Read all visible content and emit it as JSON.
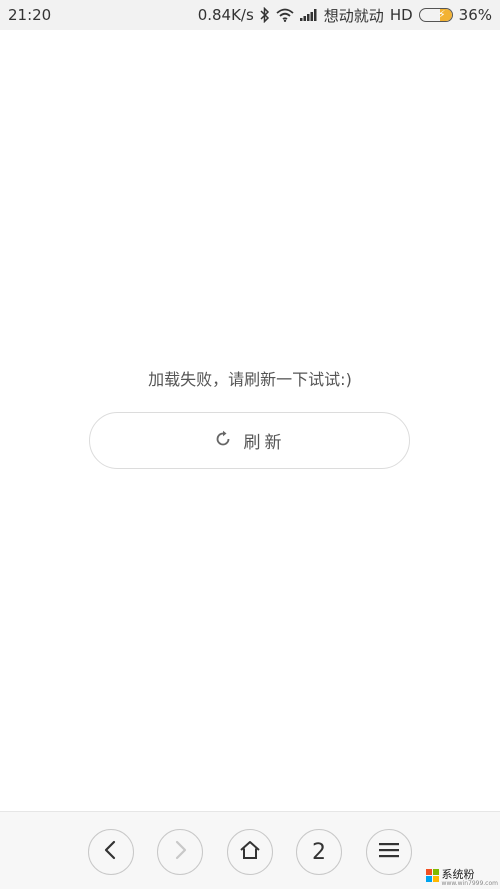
{
  "status_bar": {
    "time": "21:20",
    "network_speed": "0.84K/s",
    "carrier": "想动就动",
    "network_type": "HD",
    "battery": "36%",
    "battery_level": 0.36,
    "icons": [
      "bluetooth-icon",
      "wifi-icon",
      "signal-icon",
      "battery-icon"
    ]
  },
  "main": {
    "error_message": "加载失败，请刷新一下试试:)",
    "refresh_label": "刷新"
  },
  "bottom_bar": {
    "tabs_count": "2",
    "icons": [
      "back-icon",
      "forward-icon",
      "home-icon",
      "menu-icon"
    ]
  },
  "watermark": {
    "text": "系统粉",
    "sub": "www.win7999.com"
  },
  "colors": {
    "battery_accent": "#f2b233",
    "text": "#555555",
    "border": "#dcdcdc"
  }
}
